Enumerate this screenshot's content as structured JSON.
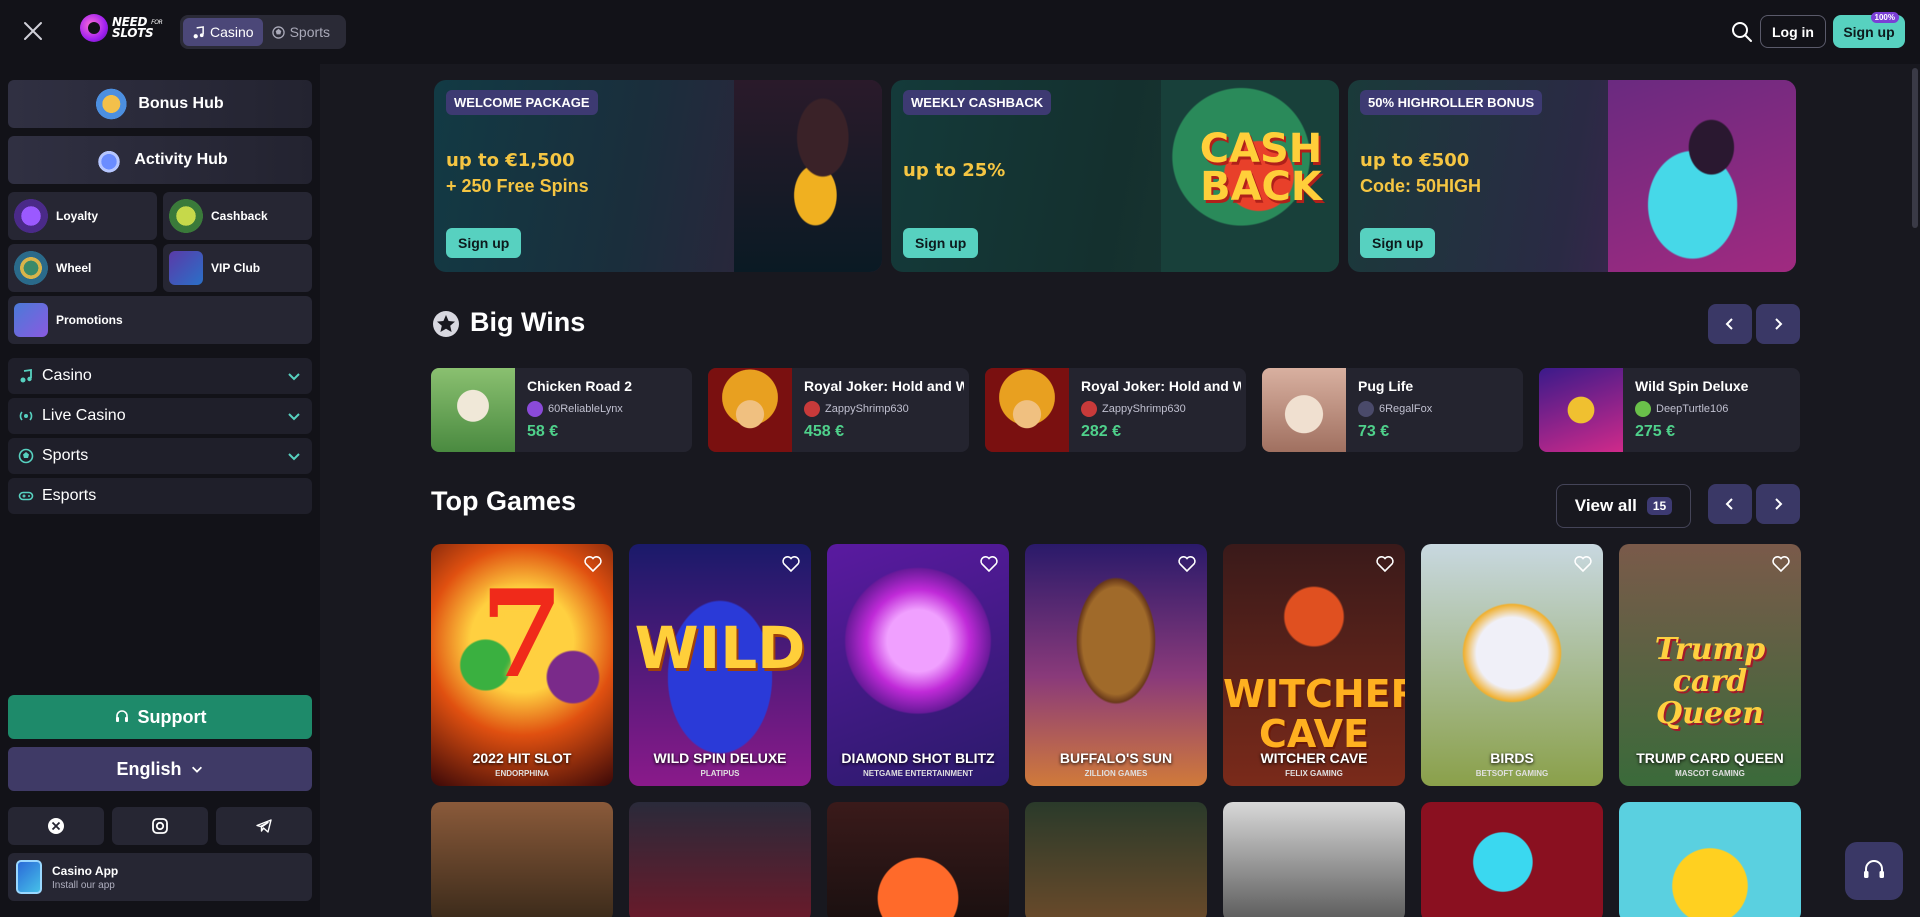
{
  "header": {
    "logo_line1": "NEED",
    "logo_for": "FOR",
    "logo_line2": "SLOTS",
    "modes": [
      "Casino",
      "Sports"
    ],
    "login_label": "Log in",
    "signup_label": "Sign up",
    "signup_badge": "100%"
  },
  "sidebar": {
    "hubs": [
      "Bonus Hub",
      "Activity Hub"
    ],
    "tiles": [
      "Loyalty",
      "Cashback",
      "Wheel",
      "VIP Club",
      "Promotions"
    ],
    "nav": [
      "Casino",
      "Live Casino",
      "Sports",
      "Esports"
    ],
    "support_label": "Support",
    "language_label": "English",
    "app_title": "Casino App",
    "app_subtitle": "Install our app"
  },
  "banners": [
    {
      "tag": "WELCOME PACKAGE",
      "line1": "up to €1,500",
      "line2": "+ 250 Free Spins",
      "cta": "Sign up"
    },
    {
      "tag": "WEEKLY CASHBACK",
      "line1": "up to 25%",
      "line2": "",
      "cta": "Sign up",
      "art_text": "CASH BACK"
    },
    {
      "tag": "50% HIGHROLLER BONUS",
      "line1": "up to €500",
      "line2": "Code: 50HIGH",
      "cta": "Sign up"
    }
  ],
  "big_wins": {
    "title": "Big Wins",
    "items": [
      {
        "game": "Chicken Road 2",
        "user": "60ReliableLynx",
        "amount": "58 €"
      },
      {
        "game": "Royal Joker: Hold and Win",
        "user": "ZappyShrimp630",
        "amount": "458 €"
      },
      {
        "game": "Royal Joker: Hold and Win",
        "user": "ZappyShrimp630",
        "amount": "282 €"
      },
      {
        "game": "Pug Life",
        "user": "6RegalFox",
        "amount": "73 €"
      },
      {
        "game": "Wild Spin Deluxe",
        "user": "DeepTurtle106",
        "amount": "275 €"
      }
    ]
  },
  "top_games": {
    "title": "Top Games",
    "view_all": "View all",
    "count": "15",
    "games": [
      {
        "title": "2022 HIT SLOT",
        "provider": "ENDORPHINA",
        "art": "7"
      },
      {
        "title": "WILD SPIN DELUXE",
        "provider": "PLATIPUS",
        "art": "WILD"
      },
      {
        "title": "DIAMOND SHOT BLITZ",
        "provider": "NETGAME ENTERTAINMENT",
        "art": ""
      },
      {
        "title": "BUFFALO'S SUN",
        "provider": "ZILLION GAMES",
        "art": ""
      },
      {
        "title": "WITCHER CAVE",
        "provider": "FELIX GAMING",
        "art": "WITCHER CAVE"
      },
      {
        "title": "BIRDS",
        "provider": "BETSOFT GAMING",
        "art": ""
      },
      {
        "title": "TRUMP CARD QUEEN",
        "provider": "MASCOT GAMING",
        "art": "Trump card Queen"
      }
    ]
  },
  "colors": {
    "accent_teal": "#57d1c0",
    "win_green": "#4fd18b",
    "purple": "#3d3a72",
    "support_green": "#1e8a6a"
  }
}
